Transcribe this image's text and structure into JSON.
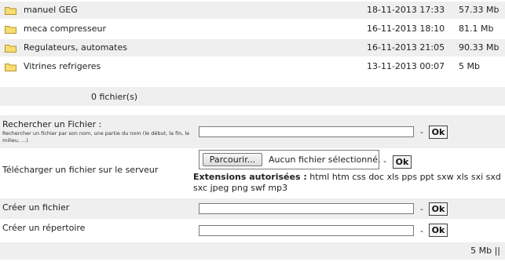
{
  "files": [
    {
      "name": "manuel GEG",
      "date": "18-11-2013 17:33",
      "size": "57.33 Mb"
    },
    {
      "name": "meca compresseur",
      "date": "16-11-2013 18:10",
      "size": "81.1 Mb"
    },
    {
      "name": "Regulateurs, automates",
      "date": "16-11-2013 21:05",
      "size": "90.33 Mb"
    },
    {
      "name": "Vitrines refrigeres",
      "date": "13-11-2013 00:07",
      "size": "5 Mb"
    }
  ],
  "file_count": "0 fichier(s)",
  "search": {
    "label": "Rechercher un Fichier :",
    "hint": "Rechercher un fichier par son nom, une partie du nom (le début, la fin, le milieu, ...)",
    "dash": "-",
    "ok": "Ok"
  },
  "upload": {
    "label": "Télécharger un fichier sur le serveur",
    "browse": "Parcourir...",
    "no_file": "Aucun fichier sélectionné.",
    "dash": "-",
    "ok": "Ok",
    "ext_label": "Extensions autorisées :",
    "ext_list": "html htm css doc xls pps ppt sxw xls sxi sxd sxc jpeg png swf mp3"
  },
  "create_file": {
    "label": "Créer un fichier",
    "dash": "-",
    "ok": "Ok"
  },
  "create_dir": {
    "label": "Créer un répertoire",
    "dash": "-",
    "ok": "Ok"
  },
  "footer": {
    "total": "5 Mb ||"
  }
}
